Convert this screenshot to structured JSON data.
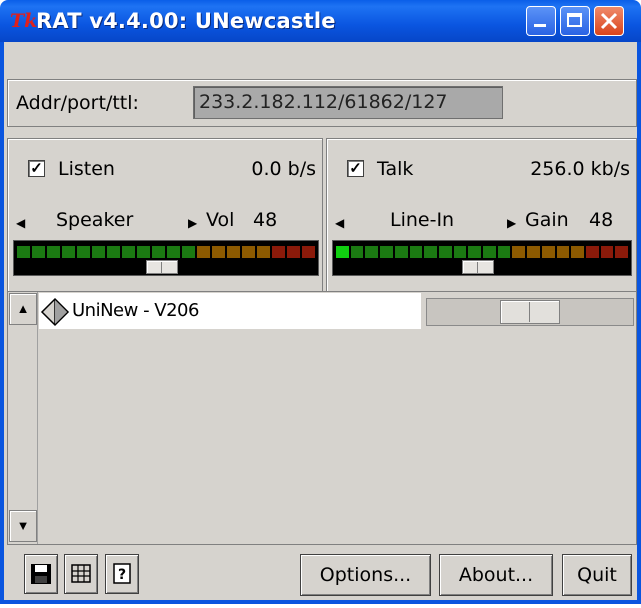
{
  "window": {
    "title": "RAT v4.4.00: UNewcastle",
    "logo_text": "Tk",
    "controls": [
      "minimize-icon",
      "maximize-icon",
      "close-icon"
    ]
  },
  "address": {
    "label": "Addr/port/ttl:",
    "value": "233.2.182.112/61862/127"
  },
  "receive": {
    "checkbox_checked": true,
    "checkbox_mark": "✓",
    "label": "Listen",
    "rate": "0.0 b/s",
    "prev_arrow": "◀",
    "device": "Speaker",
    "next_arrow": "▶",
    "level_label": "Vol",
    "level_value": "48",
    "level": 0.48
  },
  "transmit": {
    "checkbox_checked": true,
    "checkbox_mark": "✓",
    "label": "Talk",
    "rate": "256.0 kb/s",
    "prev_arrow": "◀",
    "device": "Line-In",
    "next_arrow": "▶",
    "level_label": "Gain",
    "level_value": "48",
    "level": 0.48
  },
  "participants": [
    {
      "name": "UniNew - V206",
      "volume": 0.5
    }
  ],
  "scroll": {
    "up": "▲",
    "down": "▼"
  },
  "toolbar": {
    "save_icon": "floppy-disk-icon",
    "grid_icon": "grid-icon",
    "help_icon": "help-icon",
    "options_label": "Options...",
    "about_label": "About...",
    "quit_label": "Quit"
  },
  "colors": {
    "titlebar": "#0a55df",
    "meter_green": "#1b7a12",
    "meter_lit": "#10d010",
    "meter_orange": "#8c5a00",
    "meter_red": "#8b1a0a"
  }
}
